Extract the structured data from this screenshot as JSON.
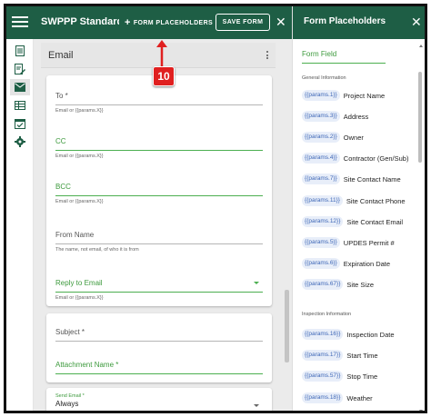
{
  "toolbar": {
    "app_title": "SWPPP Standard I",
    "form_placeholders_label": "FORM PLACEHOLDERS",
    "form_placeholders_icon": "plus-icon",
    "save_label": "SAVE FORM",
    "close_symbol": "✕"
  },
  "rail": {
    "items": [
      {
        "icon": "document-icon"
      },
      {
        "icon": "edit-document-icon"
      },
      {
        "icon": "email-icon",
        "active": true
      },
      {
        "icon": "table-icon"
      },
      {
        "icon": "calendar-check-icon"
      },
      {
        "icon": "gear-icon"
      }
    ]
  },
  "email_section": {
    "title": "Email",
    "fields": {
      "to": {
        "label": "To *",
        "hint": "Email or {{params.X}}"
      },
      "cc": {
        "label": "CC",
        "hint": "Email or {{params.X}}"
      },
      "bcc": {
        "label": "BCC",
        "hint": "Email or {{params.X}}"
      },
      "from_name": {
        "label": "From Name",
        "hint": "The name, not email, of who it is from"
      },
      "reply_to": {
        "label": "Reply to Email",
        "hint": "Email or {{params.X}}"
      },
      "subject": {
        "label": "Subject *"
      },
      "attachment": {
        "label": "Attachment Name *"
      },
      "send_email": {
        "label": "Send Email *",
        "value": "Always"
      }
    }
  },
  "annotation": {
    "step": "10"
  },
  "panel": {
    "title": "Form Placeholders",
    "close_symbol": "✕",
    "search_label": "Form Field",
    "groups": [
      {
        "heading": "General Information",
        "items": [
          {
            "chip": "{{params.1}}",
            "name": "Project Name"
          },
          {
            "chip": "{{params.3}}",
            "name": "Address"
          },
          {
            "chip": "{{params.2}}",
            "name": "Owner"
          },
          {
            "chip": "{{params.4}}",
            "name": "Contractor (Gen/Sub)"
          },
          {
            "chip": "{{params.7}}",
            "name": "Site Contact Name"
          },
          {
            "chip": "{{params.11}}",
            "name": "Site Contact Phone"
          },
          {
            "chip": "{{params.12}}",
            "name": "Site Contact Email"
          },
          {
            "chip": "{{params.5}}",
            "name": "UPDES Permit #"
          },
          {
            "chip": "{{params.6}}",
            "name": "Expiration Date"
          },
          {
            "chip": "{{params.67}}",
            "name": "Site Size"
          }
        ]
      },
      {
        "heading": "Inspection Information",
        "items": [
          {
            "chip": "{{params.16}}",
            "name": "Inspection Date"
          },
          {
            "chip": "{{params.17}}",
            "name": "Start Time"
          },
          {
            "chip": "{{params.57}}",
            "name": "Stop Time"
          },
          {
            "chip": "{{params.18}}",
            "name": "Weather"
          }
        ]
      }
    ]
  },
  "colors": {
    "header_green": "#1e5e45",
    "accent_green": "#4caf50",
    "chip_text": "#3e67b7",
    "annotation_red": "#e02020"
  }
}
